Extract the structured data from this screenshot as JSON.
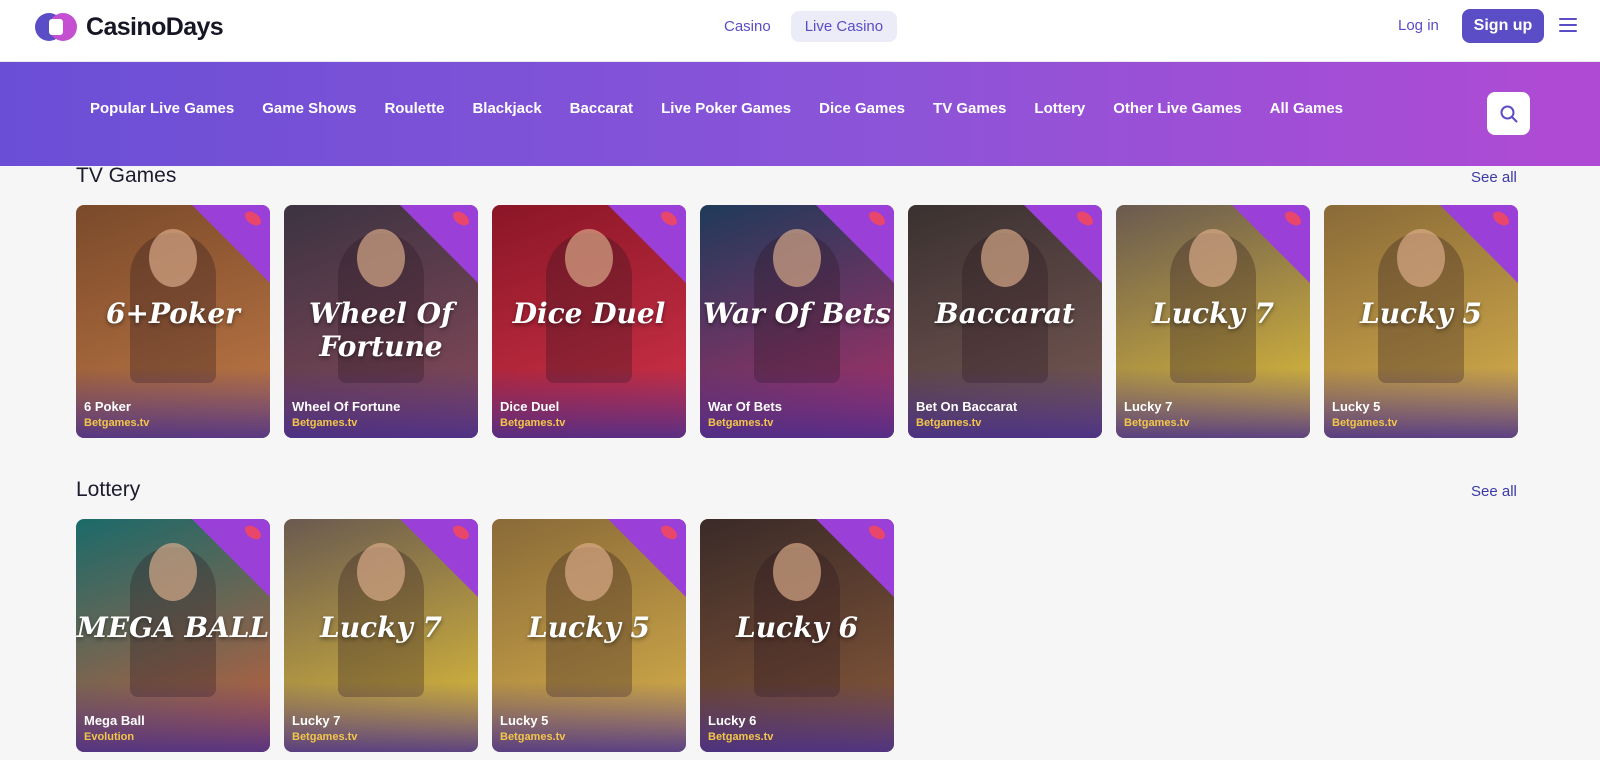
{
  "brand": {
    "name": "CasinoDays",
    "accent": "#5a4dc5"
  },
  "topnav": {
    "tabs": [
      {
        "label": "Casino",
        "active": false
      },
      {
        "label": "Live Casino",
        "active": true
      }
    ]
  },
  "auth": {
    "login_label": "Log in",
    "signup_label": "Sign up"
  },
  "icons": {
    "menu": "hamburger-menu-icon",
    "search": "search-icon"
  },
  "categories": [
    "Popular Live Games",
    "Game Shows",
    "Roulette",
    "Blackjack",
    "Baccarat",
    "Live Poker Games",
    "Dice Games",
    "TV Games",
    "Lottery",
    "Other Live Games",
    "All Games"
  ],
  "sections": [
    {
      "title": "TV Games",
      "see_all": "See all",
      "games": [
        {
          "name": "6 Poker",
          "provider": "Betgames.tv",
          "art": "6+Poker",
          "bg": [
            "#7a4a2a",
            "#c27a47"
          ]
        },
        {
          "name": "Wheel Of Fortune",
          "provider": "Betgames.tv",
          "art": "Wheel Of Fortune",
          "bg": [
            "#3c3342",
            "#8a4a5a"
          ]
        },
        {
          "name": "Dice Duel",
          "provider": "Betgames.tv",
          "art": "Dice Duel",
          "bg": [
            "#8a1626",
            "#d3334a"
          ]
        },
        {
          "name": "War Of Bets",
          "provider": "Betgames.tv",
          "art": "War Of Bets",
          "bg": [
            "#1f3a5a",
            "#b0306a"
          ]
        },
        {
          "name": "Bet On Baccarat",
          "provider": "Betgames.tv",
          "art": "Baccarat",
          "bg": [
            "#3a3130",
            "#7a5a56"
          ]
        },
        {
          "name": "Lucky 7",
          "provider": "Betgames.tv",
          "art": "Lucky 7",
          "bg": [
            "#6a5a50",
            "#e4c238"
          ]
        },
        {
          "name": "Lucky 5",
          "provider": "Betgames.tv",
          "art": "Lucky 5",
          "bg": [
            "#8a6a38",
            "#d9b24c"
          ]
        }
      ]
    },
    {
      "title": "Lottery",
      "see_all": "See all",
      "games": [
        {
          "name": "Mega Ball",
          "provider": "Evolution",
          "art": "MEGA BALL",
          "bg": [
            "#1b6a6a",
            "#c9603a"
          ]
        },
        {
          "name": "Lucky 7",
          "provider": "Betgames.tv",
          "art": "Lucky 7",
          "bg": [
            "#6a5a50",
            "#e4c238"
          ]
        },
        {
          "name": "Lucky 5",
          "provider": "Betgames.tv",
          "art": "Lucky 5",
          "bg": [
            "#8a6a38",
            "#d9b24c"
          ]
        },
        {
          "name": "Lucky 6",
          "provider": "Betgames.tv",
          "art": "Lucky 6",
          "bg": [
            "#3a2a28",
            "#8a5a3a"
          ]
        }
      ]
    }
  ]
}
